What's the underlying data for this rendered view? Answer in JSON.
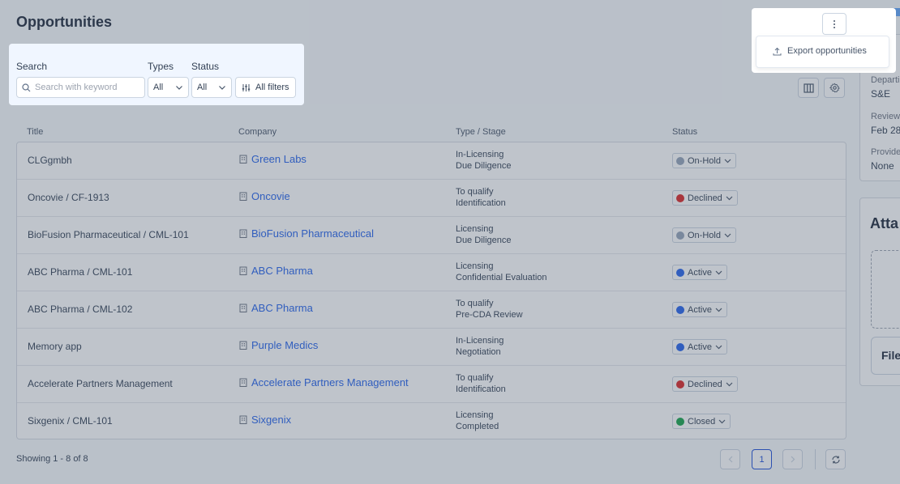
{
  "page": {
    "title": "Opportunities"
  },
  "filters": {
    "search_label": "Search",
    "search_placeholder": "Search with keyword",
    "types_label": "Types",
    "types_value": "All",
    "status_label": "Status",
    "status_value": "All",
    "all_filters_label": "All filters"
  },
  "table": {
    "columns": [
      "Title",
      "Company",
      "Type / Stage",
      "Status"
    ],
    "rows": [
      {
        "title": "CLGgmbh",
        "company": "Green Labs",
        "type": "In-Licensing",
        "stage": "Due Diligence",
        "status": "On-Hold"
      },
      {
        "title": "Oncovie / CF-1913",
        "company": "Oncovie",
        "type": "To qualify",
        "stage": "Identification",
        "status": "Declined"
      },
      {
        "title": "BioFusion Pharmaceutical / CML-101",
        "company": "BioFusion Pharmaceutical",
        "type": "Licensing",
        "stage": "Due Diligence",
        "status": "On-Hold"
      },
      {
        "title": "ABC Pharma / CML-101",
        "company": "ABC Pharma",
        "type": "Licensing",
        "stage": "Confidential Evaluation",
        "status": "Active"
      },
      {
        "title": "ABC Pharma / CML-102",
        "company": "ABC Pharma",
        "type": "To qualify",
        "stage": "Pre-CDA Review",
        "status": "Active"
      },
      {
        "title": "Memory app",
        "company": "Purple Medics",
        "type": "In-Licensing",
        "stage": "Negotiation",
        "status": "Active"
      },
      {
        "title": "Accelerate Partners Management",
        "company": "Accelerate Partners Management",
        "type": "To qualify",
        "stage": "Identification",
        "status": "Declined"
      },
      {
        "title": "Sixgenix / CML-101",
        "company": "Sixgenix",
        "type": "Licensing",
        "stage": "Completed",
        "status": "Closed"
      }
    ]
  },
  "status_colors": {
    "On-Hold": "#94a3b8",
    "Declined": "#dc2626",
    "Active": "#2563eb",
    "Closed": "#16a34a"
  },
  "footer": {
    "showing": "Showing 1 - 8 of 8",
    "current_page": "1"
  },
  "menu": {
    "export_label": "Export opportunities"
  },
  "right_panel": {
    "heading_fragment": "ta",
    "department_label": "Departi",
    "department_value": "S&E",
    "review_label": "Review",
    "review_value": "Feb 28",
    "provider_label": "Provide",
    "provider_value": "None",
    "attachments_title": "Atta",
    "file_button": "File"
  },
  "icons": {
    "search": "search-icon",
    "filter": "sliders-icon",
    "columns": "columns-icon",
    "settings": "gear-icon",
    "kebab": "kebab-icon",
    "export": "upload-icon",
    "company": "building-icon",
    "refresh": "refresh-icon"
  }
}
